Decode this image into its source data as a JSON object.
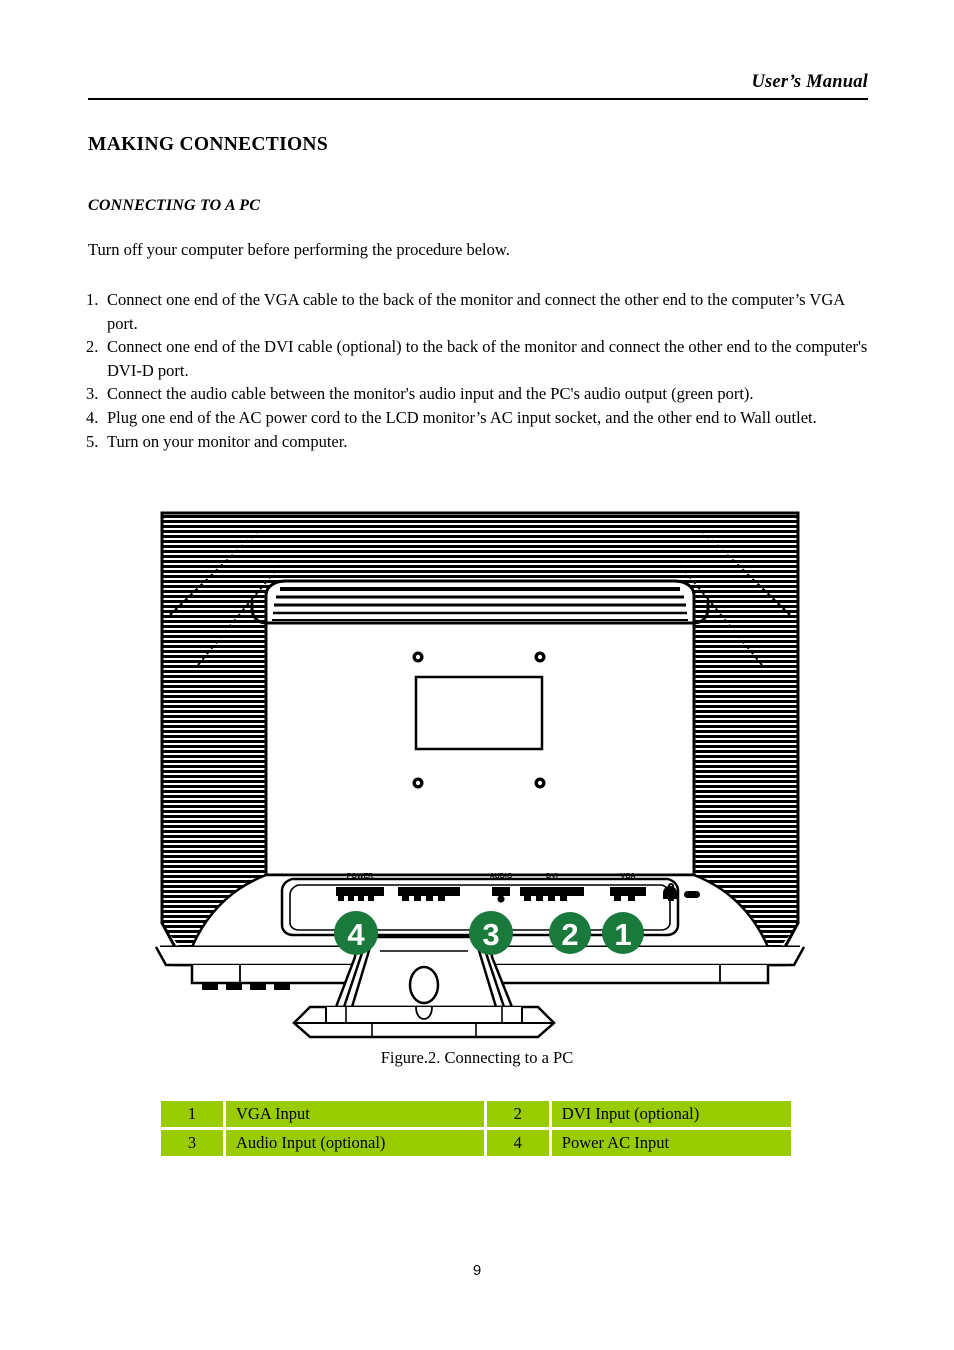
{
  "header": {
    "manual_title": "User’s Manual"
  },
  "section": {
    "title": "MAKING CONNECTIONS",
    "subtitle": "CONNECTING TO A PC",
    "intro": "Turn off your computer before performing the procedure below."
  },
  "steps": [
    {
      "num": "1.",
      "text": "Connect one end of the VGA cable to the back of the monitor and connect the other end to the computer’s VGA port."
    },
    {
      "num": "2.",
      "text": "Connect one end of the DVI cable (optional) to the back of the monitor and connect the other end to the computer's DVI-D port."
    },
    {
      "num": "3.",
      "text": "Connect the audio cable between the monitor's audio input and the PC's audio output (green port)."
    },
    {
      "num": "4.",
      "text": "Plug one end of the AC power cord to the LCD monitor’s AC input socket, and the other end to Wall outlet."
    },
    {
      "num": "5.",
      "text": "Turn on your monitor and computer."
    }
  ],
  "figure": {
    "caption": "Figure.2. Connecting to a PC",
    "callouts": [
      {
        "id": "4",
        "label": "POWER"
      },
      {
        "id": "3",
        "label": "AUDIO"
      },
      {
        "id": "2",
        "label": "DVI"
      },
      {
        "id": "1",
        "label": "VGA"
      }
    ],
    "callout_color": "#1a7a3c"
  },
  "legend": {
    "cell_color": "#99cc00",
    "rows": [
      [
        {
          "num": "1",
          "label": "VGA Input"
        },
        {
          "num": "2",
          "label": "DVI Input (optional)"
        }
      ],
      [
        {
          "num": "3",
          "label": "Audio Input (optional)"
        },
        {
          "num": "4",
          "label": "Power AC Input"
        }
      ]
    ]
  },
  "footer": {
    "page_number": "9"
  }
}
